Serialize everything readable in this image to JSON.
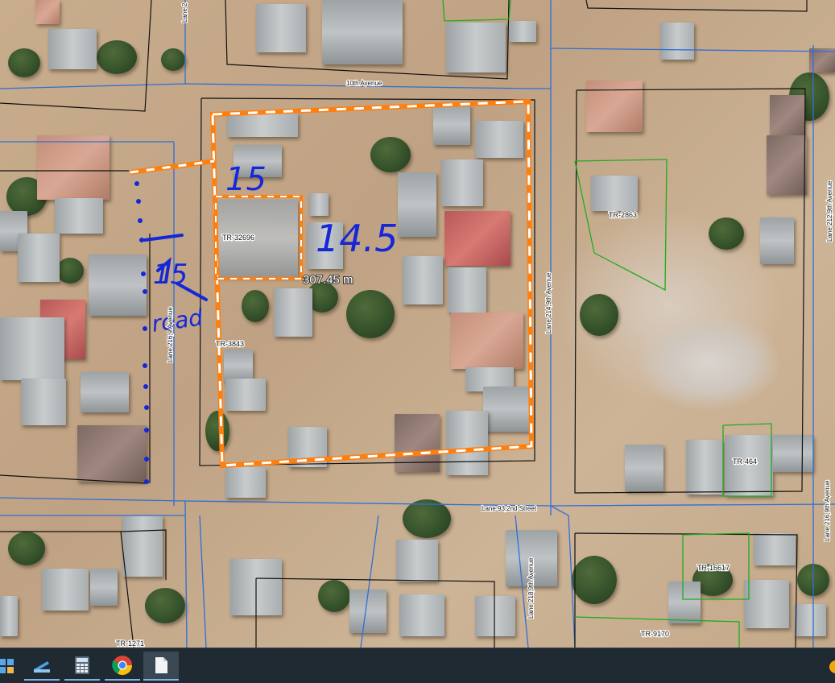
{
  "map": {
    "parcels": {
      "tr_32696": "TR-32696",
      "tr_3843": "TR-3843",
      "tr_2863": "TR-2863",
      "tr_464": "TR-464",
      "tr_16617": "TR-16617",
      "tr_9170": "TR-9170",
      "tr_1271": "TR-1271"
    },
    "roads": {
      "tenth_avenue": "10th Avenue",
      "lane_93_2nd_street": "Lane 93,2nd Street",
      "lane_214_9th_avenue": "Lane 214,9th Avenue",
      "lane_212_9th_avenue": "Lane 212,9th Avenue",
      "lane_216_9th_avenue": "Lane 216,9th Avenue",
      "lane_216_left": "Lane 216,9 Avenue",
      "lane_218_9th_avenue": "Lane 218,9th Avenue",
      "lane_top": "Lane 2"
    },
    "measurement": "307.45 m",
    "annotations": {
      "top_edge": "15",
      "right_edge": "14.5",
      "left_edge": "15",
      "road_note": "road"
    },
    "colors": {
      "measure_outline": "#ff7f0e",
      "parcel_line_blue": "#2f6fd6",
      "parcel_line_black": "#111111",
      "parcel_line_green": "#22aa22",
      "ink": "#1528d8"
    }
  },
  "taskbar": {
    "items": [
      "start-icon",
      "scanner-icon",
      "calculator-icon",
      "chrome-icon",
      "file-icon"
    ],
    "tray": [
      "notification-dot-icon"
    ]
  }
}
